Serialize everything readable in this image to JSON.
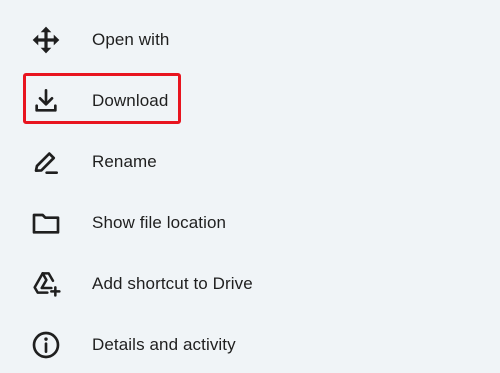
{
  "menu": {
    "items": [
      {
        "id": "open-with",
        "label": "Open with",
        "icon": "move-arrows-icon"
      },
      {
        "id": "download",
        "label": "Download",
        "icon": "download-icon"
      },
      {
        "id": "rename",
        "label": "Rename",
        "icon": "pencil-icon"
      },
      {
        "id": "show-file-location",
        "label": "Show file location",
        "icon": "folder-icon"
      },
      {
        "id": "add-shortcut",
        "label": "Add shortcut to Drive",
        "icon": "drive-add-icon"
      },
      {
        "id": "details",
        "label": "Details and activity",
        "icon": "info-icon"
      }
    ]
  },
  "colors": {
    "background": "#f0f4f7",
    "text": "#1f1f1f",
    "icon": "#1f1f1f",
    "highlight": "#e8141f"
  }
}
